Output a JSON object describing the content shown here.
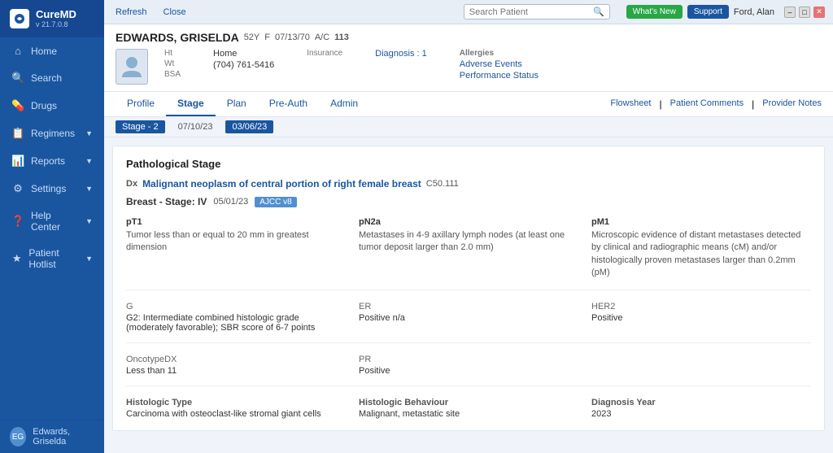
{
  "sidebar": {
    "logo": {
      "text": "CureMD",
      "version": "v 21.7.0.8"
    },
    "items": [
      {
        "label": "Home",
        "icon": "⌂",
        "active": false
      },
      {
        "label": "Search",
        "icon": "🔍",
        "active": false
      },
      {
        "label": "Drugs",
        "icon": "💊",
        "active": false
      },
      {
        "label": "Regimens",
        "icon": "📋",
        "active": false,
        "hasChevron": true
      },
      {
        "label": "Reports",
        "icon": "📊",
        "active": false,
        "hasChevron": true
      },
      {
        "label": "Settings",
        "icon": "⚙",
        "active": false,
        "hasChevron": true
      },
      {
        "label": "Help Center",
        "icon": "?",
        "active": false,
        "hasChevron": true
      },
      {
        "label": "Patient Hotlist",
        "icon": "★",
        "active": false,
        "hasChevron": true
      }
    ],
    "user": {
      "name": "Edwards, Griselda",
      "initials": "EG"
    }
  },
  "topbar": {
    "refresh_label": "Refresh",
    "close_label": "Close",
    "search_placeholder": "Search Patient",
    "whats_new": "What's New",
    "support": "Support",
    "user": "Ford, Alan"
  },
  "patient": {
    "name": "EDWARDS, GRISELDA",
    "age": "52Y",
    "gender": "F",
    "dob": "07/13/70",
    "ac": "113",
    "ht": "Ht",
    "wt": "Wt",
    "bsa": "BSA",
    "phone_label": "Home",
    "phone": "(704) 761-5416",
    "insurance_label": "Insurance",
    "diagnosis_label": "Diagnosis",
    "diagnosis_link": "Diagnosis : 1",
    "allergies_label": "Allergies",
    "adverse_events": "Adverse Events",
    "performance_status": "Performance Status"
  },
  "nav_tabs": {
    "tabs": [
      {
        "label": "Profile",
        "active": false
      },
      {
        "label": "Stage",
        "active": true
      },
      {
        "label": "Plan",
        "active": false
      },
      {
        "label": "Pre-Auth",
        "active": false
      },
      {
        "label": "Admin",
        "active": false
      }
    ],
    "right_links": [
      {
        "label": "Flowsheet"
      },
      {
        "label": "Patient Comments"
      },
      {
        "label": "Provider Notes"
      }
    ]
  },
  "stage_bar": {
    "stage_label": "Stage - 2",
    "dates": [
      {
        "value": "07/10/23",
        "active": false
      },
      {
        "value": "03/06/23",
        "active": true
      }
    ]
  },
  "content": {
    "section_title": "Pathological Stage",
    "dx_label": "Dx",
    "dx_text": "Malignant neoplasm of central portion of right female breast",
    "dx_code": "C50.111",
    "breast_stage_label": "Breast - Stage: IV",
    "breast_stage_date": "05/01/23",
    "ajcc_badge": "AJCC v8",
    "stage_cells": [
      {
        "label": "pT1",
        "value": "Tumor less than or equal to 20 mm in greatest dimension"
      },
      {
        "label": "pN2a",
        "value": "Metastases in 4-9 axillary lymph nodes (at least one tumor deposit larger than 2.0 mm)"
      },
      {
        "label": "pM1",
        "value": "Microscopic evidence of distant metastases detected by clinical and radiographic means (cM) and/or histologically proven metastases larger than 0.2mm (pM)"
      }
    ],
    "info_cells": [
      {
        "label": "G",
        "value": "G2: Intermediate combined histologic grade (moderately favorable); SBR score of 6-7 points"
      },
      {
        "label": "ER",
        "value": "Positive n/a"
      },
      {
        "label": "HER2",
        "value": "Positive"
      }
    ],
    "oncotype_cells": [
      {
        "label": "OncotypeDX",
        "value": "Less than 11"
      },
      {
        "label": "PR",
        "value": "Positive"
      },
      {
        "label": "",
        "value": ""
      }
    ],
    "bottom_cells": [
      {
        "label": "Histologic Type",
        "value": "Carcinoma with osteoclast-like stromal giant cells"
      },
      {
        "label": "Histologic Behaviour",
        "value": "Malignant, metastatic site"
      },
      {
        "label": "Diagnosis Year",
        "value": "2023"
      }
    ]
  }
}
